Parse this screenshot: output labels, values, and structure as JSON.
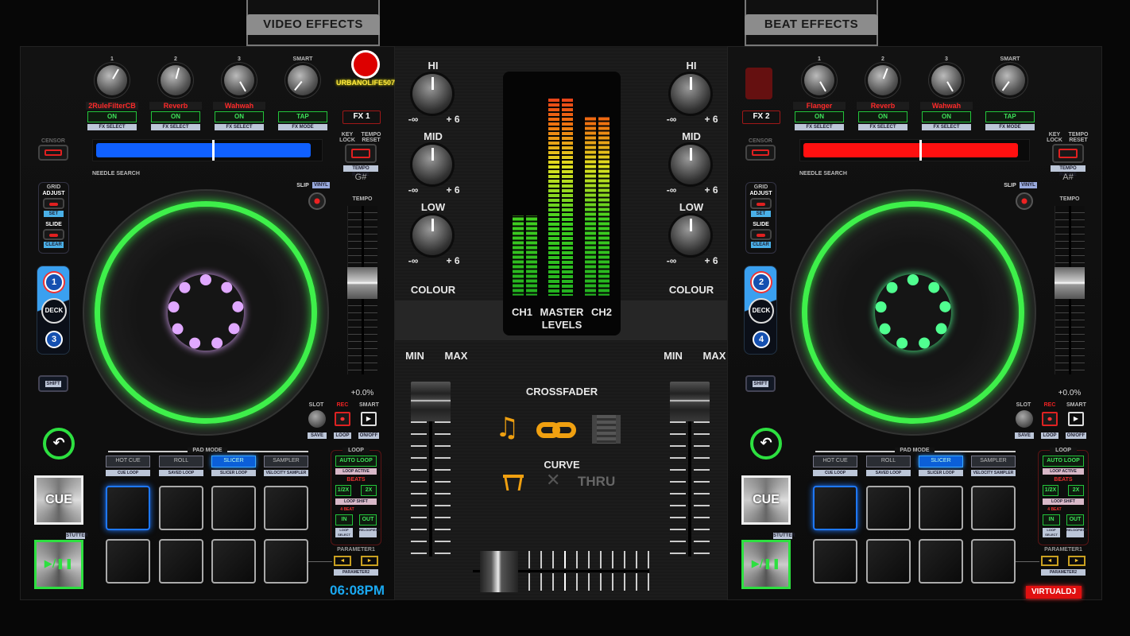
{
  "tabs": {
    "video_effects": "VIDEO EFFECTS",
    "beat_effects": "BEAT EFFECTS"
  },
  "decks": [
    {
      "fx_label": "FX 1",
      "logo_text": "URBANOLIFE507",
      "brand": "",
      "knob_labels": [
        "1",
        "2",
        "3",
        "SMART"
      ],
      "knob_values": [
        0.6,
        0.55,
        1.0,
        0.03
      ],
      "effects": [
        "2RuleFilterCB",
        "Reverb",
        "Wahwah",
        ""
      ],
      "effect_buttons": [
        "ON",
        "ON",
        "ON",
        "TAP"
      ],
      "effect_sublabels": [
        "FX SELECT",
        "FX SELECT",
        "FX SELECT",
        "FX MODE"
      ],
      "censor": "CENSOR",
      "needle_search": "NEEDLE SEARCH",
      "key_lock": "KEY LOCK",
      "tempo_reset": "TEMPO RESET",
      "tempo_range": "TEMPO RANGE",
      "key": "G#",
      "grid": "GRID",
      "adjust": "ADJUST",
      "set": "SET",
      "slide": "SLIDE",
      "clear": "CLEAR",
      "deck_top": "1",
      "deck_label": "DECK",
      "deck_bottom": "3",
      "shift": "SHIFT",
      "slip": "SLIP",
      "vinyl": "VINYL",
      "tempo": "TEMPO",
      "tempo_position": 0.45,
      "pitch": "+0.0%",
      "slot": "SLOT",
      "rec": "REC",
      "smart": "SMART",
      "save": "SAVE",
      "loop": "LOOP",
      "onoff": "ON/OFF",
      "stutter": "STUTTER",
      "cue": "CUE",
      "play_pause": "▶/❚❚",
      "pad_mode": "PAD MODE",
      "pad_tabs": [
        "HOT CUE",
        "ROLL",
        "SLICER",
        "SAMPLER"
      ],
      "active_pad_tab": 2,
      "pad_sublabels": [
        "CUE LOOP",
        "SAVED LOOP",
        "SLICER LOOP",
        "VELOCITY SAMPLER"
      ],
      "loop_panel": {
        "title": "LOOP",
        "auto_loop": "AUTO LOOP",
        "loop_active": "LOOP ACTIVE",
        "beats": "BEATS",
        "half": "1/2X",
        "double": "2X",
        "loop_shift": "LOOP SHIFT",
        "four_beat": "4 BEAT",
        "in": "IN",
        "out": "OUT",
        "reloop": "RELOOP/EXIT",
        "loop_select": "LOOP SELECT"
      },
      "parameter1": "PARAMETER1",
      "parameter2": "PARAMETER2",
      "clock": "06:08PM",
      "waveform_color": "#1060ff",
      "ring_color": "#e0a8ff"
    },
    {
      "fx_label": "FX 2",
      "logo_text": "",
      "brand": "VIRTUALDJ",
      "knob_labels": [
        "1",
        "2",
        "3",
        "SMART"
      ],
      "knob_values": [
        1.0,
        0.57,
        1.0,
        0.02
      ],
      "effects": [
        "Flanger",
        "Reverb",
        "Wahwah",
        ""
      ],
      "effect_buttons": [
        "ON",
        "ON",
        "ON",
        "TAP"
      ],
      "effect_sublabels": [
        "FX SELECT",
        "FX SELECT",
        "FX SELECT",
        "FX MODE"
      ],
      "censor": "CENSOR",
      "needle_search": "NEEDLE SEARCH",
      "key_lock": "KEY LOCK",
      "tempo_reset": "TEMPO RESET",
      "tempo_range": "TEMPO RANGE",
      "key": "A#",
      "grid": "GRID",
      "adjust": "ADJUST",
      "set": "SET",
      "slide": "SLIDE",
      "clear": "CLEAR",
      "deck_top": "2",
      "deck_label": "DECK",
      "deck_bottom": "4",
      "shift": "SHIFT",
      "slip": "SLIP",
      "vinyl": "VINYL",
      "tempo": "TEMPO",
      "tempo_position": 0.45,
      "pitch": "+0.0%",
      "slot": "SLOT",
      "rec": "REC",
      "smart": "SMART",
      "save": "SAVE",
      "loop": "LOOP",
      "onoff": "ON/OFF",
      "stutter": "STUTTER",
      "cue": "CUE",
      "play_pause": "▶/❚❚",
      "pad_mode": "PAD MODE",
      "pad_tabs": [
        "HOT CUE",
        "ROLL",
        "SLICER",
        "SAMPLER"
      ],
      "active_pad_tab": 2,
      "pad_sublabels": [
        "CUE LOOP",
        "SAVED LOOP",
        "SLICER LOOP",
        "VELOCITY SAMPLER"
      ],
      "loop_panel": {
        "title": "LOOP",
        "auto_loop": "AUTO LOOP",
        "loop_active": "LOOP ACTIVE",
        "beats": "BEATS",
        "half": "1/2X",
        "double": "2X",
        "loop_shift": "LOOP SHIFT",
        "four_beat": "4 BEAT",
        "in": "IN",
        "out": "OUT",
        "reloop": "RELOOP/EXIT",
        "loop_select": "LOOP SELECT"
      },
      "parameter1": "PARAMETER1",
      "parameter2": "PARAMETER2",
      "clock": "",
      "waveform_color": "#ff1010",
      "ring_color": "#50ff90"
    }
  ],
  "mixer": {
    "eq": {
      "hi": "HI",
      "mid": "MID",
      "low": "LOW",
      "colour": "COLOUR",
      "min_label": "-∞",
      "max_label": "+ 6",
      "values": [
        0.5,
        0.5,
        0.5
      ]
    },
    "meter": {
      "ch1": "CH1",
      "master": "MASTER",
      "ch2": "CH2",
      "levels_label": "LEVELS",
      "ch1_level": 0.37,
      "master_level": 0.92,
      "ch2_level": 0.83
    },
    "gain": {
      "min": "MIN",
      "max": "MAX"
    },
    "crossfader": {
      "title": "CROSSFADER",
      "curve": "CURVE",
      "thru": "THRU",
      "position": 0.05,
      "accent": "#f0a010"
    },
    "channel_fader_positions": [
      1.0,
      1.0
    ]
  }
}
